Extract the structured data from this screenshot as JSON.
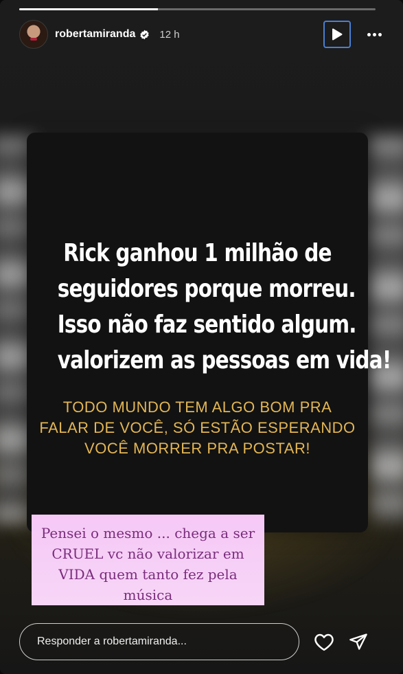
{
  "story": {
    "progress_fraction": 0.39
  },
  "header": {
    "username": "robertamiranda",
    "time": "12 h",
    "avatar_icon": "profile-avatar",
    "verified_icon": "verified-badge-icon",
    "play_icon": "play-icon",
    "more_icon": "more-options-icon"
  },
  "card": {
    "headline_lines": [
      "Rick ganhou 1 milhão de",
      "seguidores porque morreu.",
      "Isso não faz sentido algum.",
      "valorizem as pessoas em vida!"
    ],
    "subline_lines": [
      "TODO MUNDO TEM ALGO BOM PRA",
      "FALAR DE VOCÊ, SÓ ESTÃO ESPERANDO",
      "VOCÊ MORRER PRA POSTAR!"
    ],
    "subline_color": "#e3b655"
  },
  "sticker": {
    "lines": [
      "Pensei o mesmo ... chega a ser",
      "CRUEL vc não valorizar em",
      "VIDA quem tanto fez pela",
      "música"
    ],
    "background": "#f6c8f6",
    "text_color": "#7a2c7c"
  },
  "footer": {
    "reply_placeholder": "Responder a robertamiranda...",
    "like_icon": "heart-icon",
    "share_icon": "send-icon"
  }
}
